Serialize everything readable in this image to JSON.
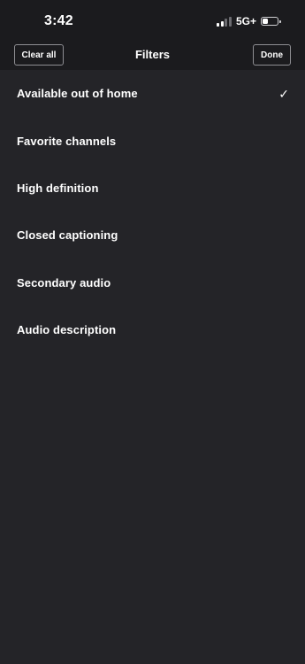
{
  "status_bar": {
    "time": "3:42",
    "network": "5G+",
    "signal_bars_active": 2,
    "signal_bars_total": 4,
    "battery_level": 0.35
  },
  "nav": {
    "clear_label": "Clear all",
    "title": "Filters",
    "done_label": "Done"
  },
  "filters": [
    {
      "label": "Available out of home",
      "checked": true
    },
    {
      "label": "Favorite channels",
      "checked": false
    },
    {
      "label": "High definition",
      "checked": false
    },
    {
      "label": "Closed captioning",
      "checked": false
    },
    {
      "label": "Secondary audio",
      "checked": false
    },
    {
      "label": "Audio description",
      "checked": false
    }
  ],
  "check_glyph": "✓",
  "colors": {
    "background": "#242428",
    "bar_background": "#1b1b1e",
    "text": "#ffffff",
    "button_border": "#8e8e93"
  }
}
